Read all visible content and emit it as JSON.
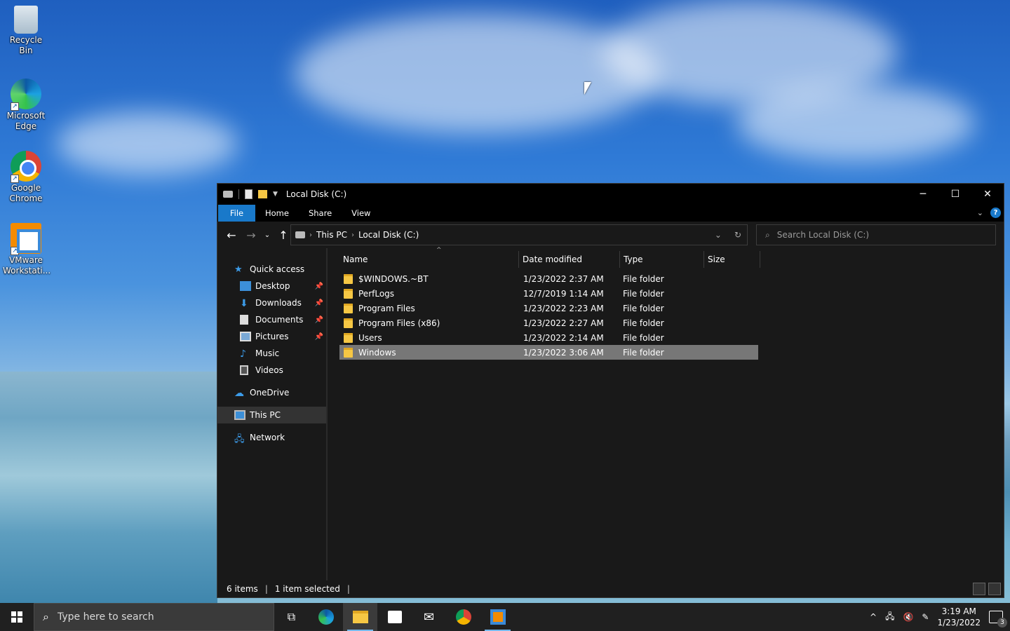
{
  "desktop": {
    "icons": [
      {
        "label": "Recycle Bin",
        "icon": "recycle-bin-icon"
      },
      {
        "label": "Microsoft Edge",
        "icon": "edge-icon"
      },
      {
        "label": "Google Chrome",
        "icon": "chrome-icon"
      },
      {
        "label": "VMware Workstati...",
        "icon": "vmware-icon"
      }
    ]
  },
  "explorer": {
    "title": "Local Disk (C:)",
    "ribbon_tabs": [
      "File",
      "Home",
      "Share",
      "View"
    ],
    "help_label": "?",
    "address": {
      "crumbs": [
        "This PC",
        "Local Disk (C:)"
      ]
    },
    "search": {
      "placeholder": "Search Local Disk (C:)"
    },
    "nav": {
      "quick_access": "Quick access",
      "items": [
        {
          "label": "Desktop",
          "icon": "desktop-folder-icon",
          "pinned": true
        },
        {
          "label": "Downloads",
          "icon": "downloads-icon",
          "pinned": true
        },
        {
          "label": "Documents",
          "icon": "documents-icon",
          "pinned": true
        },
        {
          "label": "Pictures",
          "icon": "pictures-icon",
          "pinned": true
        },
        {
          "label": "Music",
          "icon": "music-icon",
          "pinned": false
        },
        {
          "label": "Videos",
          "icon": "videos-icon",
          "pinned": false
        }
      ],
      "onedrive": "OneDrive",
      "this_pc": "This PC",
      "network": "Network"
    },
    "columns": {
      "name": "Name",
      "date": "Date modified",
      "type": "Type",
      "size": "Size"
    },
    "files": [
      {
        "name": "$WINDOWS.~BT",
        "date": "1/23/2022 2:37 AM",
        "type": "File folder",
        "selected": false
      },
      {
        "name": "PerfLogs",
        "date": "12/7/2019 1:14 AM",
        "type": "File folder",
        "selected": false
      },
      {
        "name": "Program Files",
        "date": "1/23/2022 2:23 AM",
        "type": "File folder",
        "selected": false
      },
      {
        "name": "Program Files (x86)",
        "date": "1/23/2022 2:27 AM",
        "type": "File folder",
        "selected": false
      },
      {
        "name": "Users",
        "date": "1/23/2022 2:14 AM",
        "type": "File folder",
        "selected": false
      },
      {
        "name": "Windows",
        "date": "1/23/2022 3:06 AM",
        "type": "File folder",
        "selected": true
      }
    ],
    "status": {
      "items": "6 items",
      "selected": "1 item selected"
    }
  },
  "taskbar": {
    "search_placeholder": "Type here to search",
    "apps": [
      "task-view-icon",
      "edge-icon",
      "file-explorer-icon",
      "microsoft-store-icon",
      "mail-icon",
      "chrome-icon",
      "vmware-icon"
    ],
    "clock": {
      "time": "3:19 AM",
      "date": "1/23/2022"
    },
    "notification_count": "3"
  },
  "colors": {
    "accent": "#1979ca",
    "window_bg": "#191919",
    "selection": "#777777",
    "taskbar": "#202020"
  }
}
